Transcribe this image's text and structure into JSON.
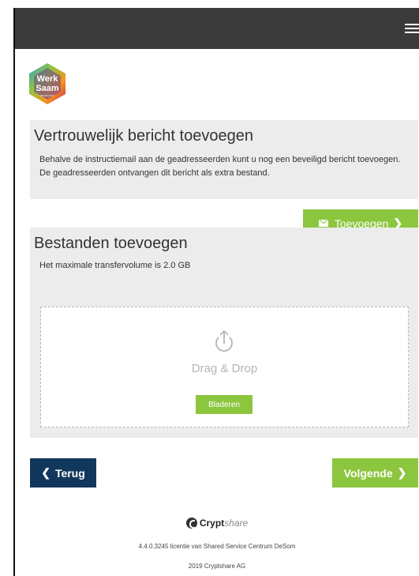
{
  "header": {
    "menu_icon": "hamburger-menu-icon"
  },
  "logo": {
    "line1": "Werk",
    "line2": "Saam",
    "line3": "Westfriesland"
  },
  "message_section": {
    "title": "Vertrouwelijk bericht toevoegen",
    "description": "Behalve de instructiemail aan de geadresseerden kunt u nog een beveiligd bericht toevoegen. De geadresseerden ontvangen dit bericht als extra bestand.",
    "add_button": "Toevoegen",
    "add_button_icon": "envelope-icon"
  },
  "files_section": {
    "title": "Bestanden toevoegen",
    "limit_text": "Het maximale transfervolume is 2.0 GB",
    "drop_label": "Drag & Drop",
    "browse_button": "Bladeren",
    "upload_icon": "upload-icon"
  },
  "navigation": {
    "back_button": "Terug",
    "next_button": "Volgende"
  },
  "footer": {
    "brand_name": "Crypt",
    "brand_suffix": "share",
    "license_text": "4.4.0.3245 licentie van Shared Service Centrum DeSom",
    "copyright": "2019 Cryptshare AG"
  },
  "colors": {
    "topbar": "#3a3a3a",
    "panel": "#ececec",
    "accent_green": "#8cc63f",
    "back_button": "#12375c"
  }
}
